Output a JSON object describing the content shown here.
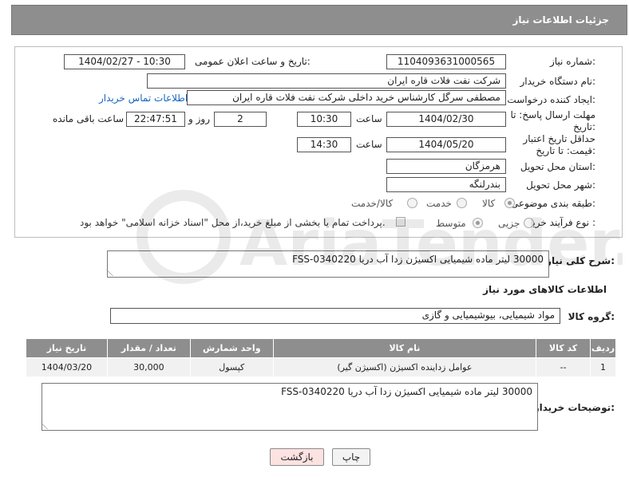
{
  "header": {
    "title": "جزئیات اطلاعات نیاز"
  },
  "fields": {
    "need_number_label": "شماره نیاز:",
    "need_number": "1104093631000565",
    "announce_label": "تاریخ و ساعت اعلان عمومی:",
    "announce_value": "1404/02/27 - 10:30",
    "buyer_org_label": "نام دستگاه خریدار:",
    "buyer_org": "شرکت نفت فلات قاره ایران",
    "requester_label": "ایجاد کننده درخواست:",
    "requester": "مصطفی سرگل کارشناس خرید داخلی شرکت نفت فلات قاره ایران",
    "buyer_contact_link": "اطلاعات تماس خریدار",
    "reply_deadline_label": "مهلت ارسال پاسخ: تا تاریخ:",
    "reply_date": "1404/02/30",
    "hour_label": "ساعت",
    "reply_time": "10:30",
    "days_value": "2",
    "days_label": "روز و",
    "remaining_time": "22:47:51",
    "remaining_label": "ساعت باقی مانده",
    "price_validity_label": "حداقل تاریخ اعتبار قیمت: تا تاریخ:",
    "validity_date": "1404/05/20",
    "validity_time": "14:30",
    "province_label": "استان محل تحویل:",
    "province": "هرمزگان",
    "city_label": "شهر محل تحویل:",
    "city": "بندرلنگه",
    "category_label": "طبقه بندی موضوعی:",
    "category_options": [
      "کالا",
      "خدمت",
      "کالا/خدمت"
    ],
    "process_label": "نوع فرآیند خرید :",
    "process_options": [
      "جزیی",
      "متوسط"
    ],
    "payment_note": "پرداخت تمام یا بخشی از مبلغ خرید،از محل \"اسناد خزانه اسلامی\" خواهد بود."
  },
  "description": {
    "label": "شرح کلی نیاز:",
    "value": "30000 لیتر ماده شیمیایی اکسیژن زدا آب دریا FSS-0340220"
  },
  "goods": {
    "section_title": "اطلاعات کالاهای مورد نیاز",
    "group_label": "گروه کالا:",
    "group_value": "مواد شیمیایی، بیوشیمیایی و  گازی",
    "columns": [
      "ردیف",
      "کد کالا",
      "نام کالا",
      "واحد شمارش",
      "تعداد / مقدار",
      "تاریخ نیاز"
    ],
    "rows": [
      [
        "1",
        "--",
        "عوامل زداینده اکسیژن (اکسیژن گیر)",
        "کپسول",
        "30,000",
        "1404/03/20"
      ]
    ]
  },
  "buyer_notes": {
    "label": "توضیحات خریدار:",
    "value": "30000 لیتر ماده شیمیایی اکسیژن زدا آب دریا FSS-0340220"
  },
  "buttons": {
    "print": "چاپ",
    "back": "بازگشت"
  },
  "watermark": {
    "text": "AriaTender.net"
  },
  "colors": {
    "header_bg": "#8e8e8e",
    "link": "#1565c0",
    "back_button_bg": "#fde2e2"
  }
}
